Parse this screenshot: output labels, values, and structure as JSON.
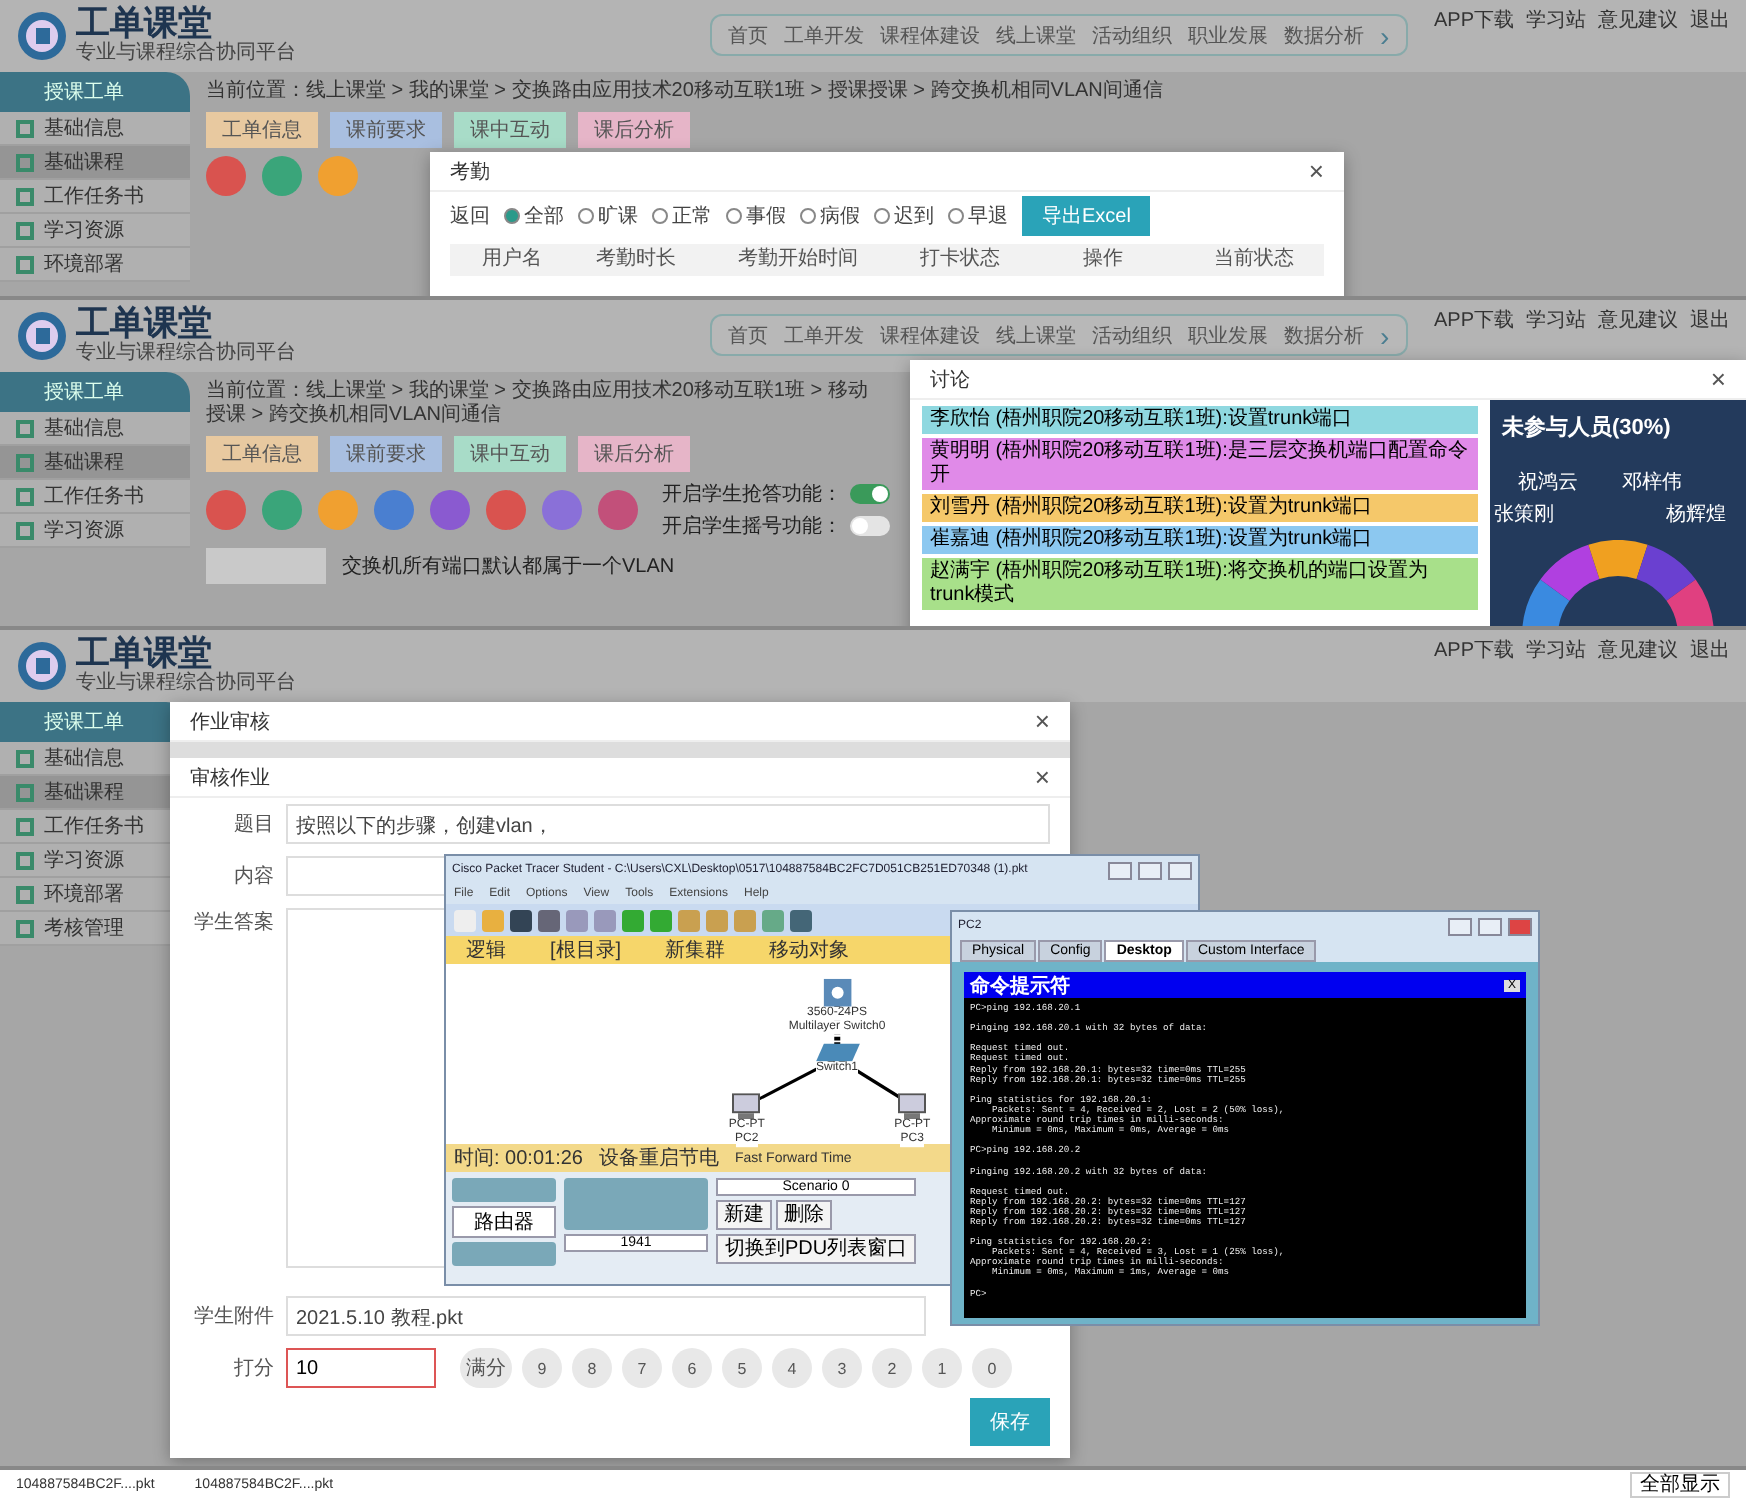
{
  "attendance_screen": {
    "header": {
      "logo_text": "工单课堂",
      "logo_subtitle": "专业与课程综合协同平台",
      "nav": [
        "首页",
        "工单开发",
        "课程体建设",
        "线上课堂",
        "活动组织",
        "职业发展",
        "数据分析"
      ],
      "nav_next": "›",
      "top_links": [
        "APP下载",
        "学习站",
        "意见建议",
        "退出"
      ]
    },
    "sidebar": {
      "section": "授课工单",
      "items": [
        {
          "label": "基础信息",
          "selected": false
        },
        {
          "label": "基础课程",
          "selected": true
        },
        {
          "label": "工作任务书",
          "selected": false
        },
        {
          "label": "学习资源",
          "selected": false
        },
        {
          "label": "环境部署",
          "selected": false
        }
      ]
    },
    "breadcrumb": "当前位置：线上课堂 > 我的课堂 > 交换路由应用技术20移动互联1班 > 授课授课 > 跨交换机相同VLAN间通信",
    "tabs": [
      {
        "label": "工单信息",
        "color": "#e8c9a0"
      },
      {
        "label": "课前要求",
        "color": "#a9bfe0"
      },
      {
        "label": "课中互动",
        "color": "#a8dcc8"
      },
      {
        "label": "课后分析",
        "color": "#e6b5c8"
      }
    ],
    "activity_icons": [
      {
        "color": "#d9534f"
      },
      {
        "color": "#3aa57a"
      },
      {
        "color": "#f0a030"
      }
    ],
    "dialog": {
      "title": "考勤",
      "close": "×",
      "back": "返回",
      "filters": [
        {
          "label": "全部",
          "selected": true
        },
        {
          "label": "旷课",
          "selected": false
        },
        {
          "label": "正常",
          "selected": false
        },
        {
          "label": "事假",
          "selected": false
        },
        {
          "label": "病假",
          "selected": false
        },
        {
          "label": "迟到",
          "selected": false
        },
        {
          "label": "早退",
          "selected": false
        }
      ],
      "export_button": "导出Excel",
      "columns": [
        "用户名",
        "考勤时长",
        "考勤开始时间",
        "打卡状态",
        "操作",
        "当前状态"
      ]
    }
  },
  "discussion_screen": {
    "header": {
      "logo_text": "工单课堂",
      "logo_subtitle": "专业与课程综合协同平台",
      "nav": [
        "首页",
        "工单开发",
        "课程体建设",
        "线上课堂",
        "活动组织",
        "职业发展",
        "数据分析"
      ],
      "nav_next": "›",
      "top_links": [
        "APP下载",
        "学习站",
        "意见建议",
        "退出"
      ]
    },
    "sidebar": {
      "section": "授课工单",
      "items": [
        {
          "label": "基础信息",
          "selected": false
        },
        {
          "label": "基础课程",
          "selected": true
        },
        {
          "label": "工作任务书",
          "selected": false
        },
        {
          "label": "学习资源",
          "selected": false
        }
      ]
    },
    "breadcrumb": "当前位置：线上课堂 > 我的课堂 > 交换路由应用技术20移动互联1班 > 移动授课 > 跨交换机相同VLAN间通信",
    "tabs": [
      {
        "label": "工单信息",
        "color": "#e8c9a0"
      },
      {
        "label": "课前要求",
        "color": "#a9bfe0"
      },
      {
        "label": "课中互动",
        "color": "#a8dcc8"
      },
      {
        "label": "课后分析",
        "color": "#e6b5c8"
      }
    ],
    "activity_icons": [
      {
        "color": "#d9534f"
      },
      {
        "color": "#3aa57a"
      },
      {
        "color": "#f0a030"
      },
      {
        "color": "#4a7fd0"
      },
      {
        "color": "#8a5ad0"
      },
      {
        "color": "#d9534f"
      },
      {
        "color": "#8a70d8"
      },
      {
        "color": "#c2507a"
      }
    ],
    "toggles": [
      {
        "label": "开启学生抢答功能：",
        "on": true
      },
      {
        "label": "开启学生摇号功能：",
        "on": false
      }
    ],
    "question": "交换机所有端口默认都属于一个VLAN",
    "dialog": {
      "title": "讨论",
      "close": "×",
      "comments": [
        {
          "text": "李欣怡 (梧州职院20移动互联1班):设置trunk端口",
          "color": "#8fd8e0"
        },
        {
          "text": "黄明明 (梧州职院20移动互联1班):是三层交换机端口配置命令开",
          "color": "#e08ae8"
        },
        {
          "text": "刘雪丹 (梧州职院20移动互联1班):设置为trunk端口",
          "color": "#f5c86a"
        },
        {
          "text": "崔嘉迪 (梧州职院20移动互联1班):设置为trunk端口",
          "color": "#8cc8f0"
        },
        {
          "text": "赵满宇 (梧州职院20移动互联1班):将交换机的端口设置为trunk模式",
          "color": "#a8e08a"
        }
      ],
      "chart": {
        "title": "未参与人员(30%)",
        "names": [
          "祝鸿云",
          "邓梓伟",
          "张策刚",
          "杨辉煌"
        ]
      }
    }
  },
  "homework_screen": {
    "header": {
      "logo_text": "工单课堂",
      "logo_subtitle": "专业与课程综合协同平台",
      "top_links": [
        "APP下载",
        "学习站",
        "意见建议",
        "退出"
      ]
    },
    "sidebar": {
      "section": "授课工单",
      "items": [
        {
          "label": "基础信息",
          "selected": false
        },
        {
          "label": "基础课程",
          "selected": true
        },
        {
          "label": "工作任务书",
          "selected": false
        },
        {
          "label": "学习资源",
          "selected": false
        },
        {
          "label": "环境部署",
          "selected": false
        },
        {
          "label": "考核管理",
          "selected": false
        }
      ]
    },
    "dialog": {
      "title": "作业审核",
      "close": "×",
      "inner_title": "审核作业",
      "inner_close": "×",
      "question_label": "题目",
      "question": "按照以下的步骤，创建vlan，",
      "content_label": "内容",
      "answer_label": "学生答案",
      "attachment_label": "学生附件",
      "attachment": "2021.5.10 教程.pkt",
      "score_label": "打分",
      "score": "10",
      "score_options": [
        "满分",
        "9",
        "8",
        "7",
        "6",
        "5",
        "4",
        "3",
        "2",
        "1",
        "0"
      ],
      "save_button": "保存"
    },
    "packet_tracer": {
      "title": "Cisco Packet Tracer Student - C:\\Users\\CXL\\Desktop\\0517\\104887584BC2FC7D051CB251ED70348 (1).pkt",
      "menu": [
        "File",
        "Edit",
        "Options",
        "View",
        "Tools",
        "Extensions",
        "Help"
      ],
      "workspace_bar": [
        "逻辑",
        "[根目录]",
        "新集群",
        "移动对象"
      ],
      "devices": [
        {
          "kind": "multilayer",
          "labels": [
            "3560-24PS",
            "Multilayer Switch0"
          ]
        },
        {
          "kind": "switch",
          "labels": [
            "Switch1"
          ]
        },
        {
          "kind": "pc",
          "labels": [
            "PC-PT",
            "PC2"
          ]
        },
        {
          "kind": "pc",
          "labels": [
            "PC-PT",
            "PC3"
          ]
        }
      ],
      "time": "时间: 00:01:26",
      "power": "设备重启节电",
      "fast_forward": "Fast Forward Time",
      "device_category": "路由器",
      "device_model": "1941",
      "scenario": "Scenario 0",
      "new_button": "新建",
      "delete_button": "删除",
      "pdu_button": "切换到PDU列表窗口"
    },
    "pc_window": {
      "title": "PC2",
      "tabs": [
        {
          "label": "Physical",
          "selected": false
        },
        {
          "label": "Config",
          "selected": false
        },
        {
          "label": "Desktop",
          "selected": true
        },
        {
          "label": "Custom Interface",
          "selected": false
        }
      ],
      "cmd_title": "命令提示符",
      "cmd_close": "X",
      "output": "PC>ping 192.168.20.1\n\nPinging 192.168.20.1 with 32 bytes of data:\n\nRequest timed out.\nRequest timed out.\nReply from 192.168.20.1: bytes=32 time=0ms TTL=255\nReply from 192.168.20.1: bytes=32 time=0ms TTL=255\n\nPing statistics for 192.168.20.1:\n    Packets: Sent = 4, Received = 2, Lost = 2 (50% loss),\nApproximate round trip times in milli-seconds:\n    Minimum = 0ms, Maximum = 0ms, Average = 0ms\n\nPC>ping 192.168.20.2\n\nPinging 192.168.20.2 with 32 bytes of data:\n\nRequest timed out.\nReply from 192.168.20.2: bytes=32 time=0ms TTL=127\nReply from 192.168.20.2: bytes=32 time=0ms TTL=127\nReply from 192.168.20.2: bytes=32 time=0ms TTL=127\n\nPing statistics for 192.168.20.2:\n    Packets: Sent = 4, Received = 3, Lost = 1 (25% loss),\nApproximate round trip times in milli-seconds:\n    Minimum = 0ms, Maximum = 1ms, Average = 0ms\n\nPC>"
    }
  },
  "download_bar": {
    "items": [
      "104887584BC2F....pkt",
      "104887584BC2F....pkt"
    ],
    "show_all": "全部显示"
  }
}
